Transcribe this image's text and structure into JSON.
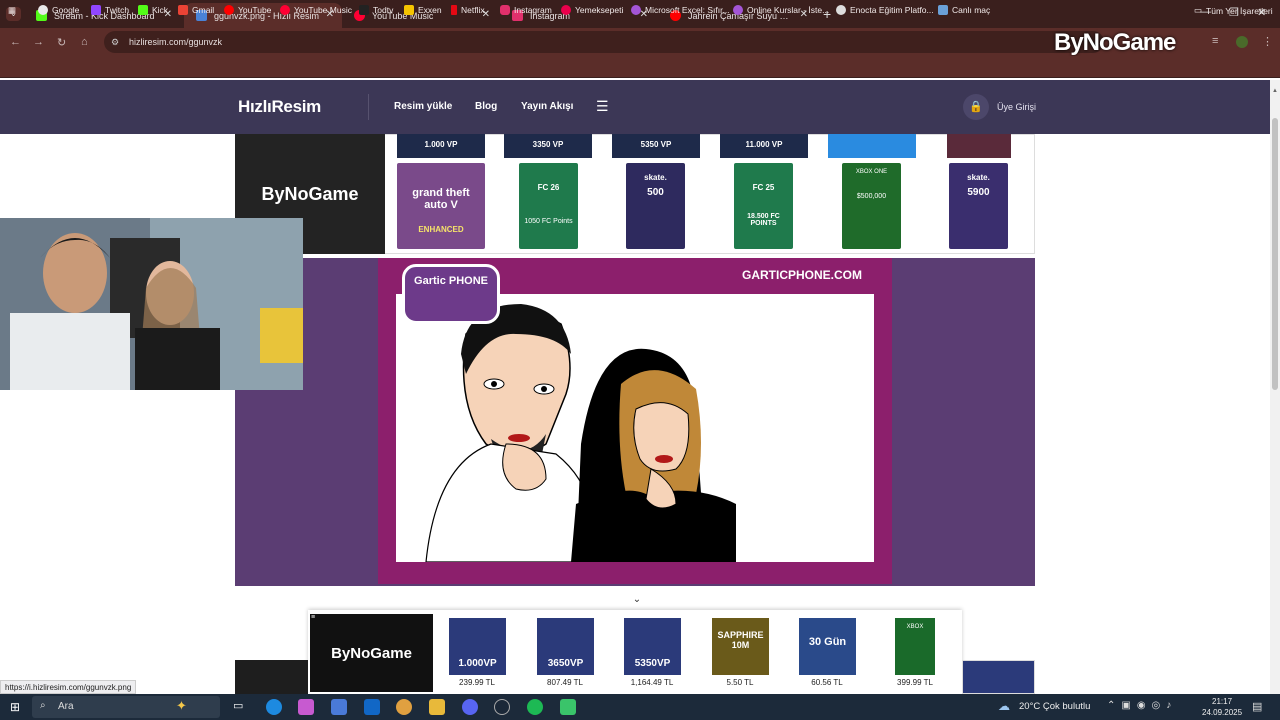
{
  "browser": {
    "tabs": [
      {
        "label": "Stream - Kick Dashboard",
        "color": "#53fc18"
      },
      {
        "label": "ggunvzk.png - Hızlı Resim",
        "color": "#3c3756"
      },
      {
        "label": "YouTube Music",
        "color": "#ff0033"
      },
      {
        "label": "Instagram",
        "color": "#e1306c"
      },
      {
        "label": "Jahrein Çamaşır Suyu Milkshake",
        "color": "#ff0000"
      }
    ],
    "new_tab": "+",
    "url": "hizliresim.com/ggunvzk",
    "bookmarks": [
      "Google",
      "Twitch",
      "Kick",
      "Gmail",
      "YouTube",
      "YouTube Music",
      "Todtv",
      "Exxen",
      "Netflix",
      "Instagram",
      "Yemeksepeti",
      "Microsoft Excel: Sıfır...",
      "Online Kurslar - İste...",
      "Enocta Eğitim Platfo...",
      "Canlı maç"
    ],
    "all_bookmarks": "Tüm Yer İşaretleri",
    "status_url": "https://i.hizliresim.com/ggunvzk.png"
  },
  "overlay_brand": "ByNoGame",
  "site": {
    "logo": "HızlıResim",
    "nav": [
      "Resim yükle",
      "Blog",
      "Yayın Akışı"
    ],
    "login": "Üye Girişi"
  },
  "ad_top": {
    "brand": "ByNoGame",
    "top_cards": [
      "1.000 VP",
      "3350 VP",
      "5350 VP",
      "11.000 VP"
    ],
    "cards": [
      {
        "title": "grand theft auto V",
        "sub": "ENHANCED",
        "color": "#7a4a8a"
      },
      {
        "title": "FC 26",
        "sub": "1050 FC Points",
        "color": "#1f7a4c"
      },
      {
        "title": "skate.",
        "sub": "500",
        "color": "#2e2a5e"
      },
      {
        "title": "FC 25",
        "sub": "18.500 FC POINTS",
        "color": "#1f7a4c"
      },
      {
        "title": "XBOX ONE",
        "sub": "$500,000",
        "color": "#1f6b2a"
      },
      {
        "title": "skate.",
        "sub": "5900",
        "color": "#3a2e6e"
      }
    ]
  },
  "image": {
    "watermark": "GARTICPHONE.COM",
    "logo_text": "Gartic PHONE"
  },
  "ad_bottom": {
    "brand": "ByNoGame",
    "items": [
      {
        "label": "1.000VP",
        "price": "239.99 TL",
        "color": "#2b3a7a"
      },
      {
        "label": "3650VP",
        "price": "807.49 TL",
        "color": "#2b3a7a"
      },
      {
        "label": "5350VP",
        "price": "1,164.49 TL",
        "color": "#2b3a7a"
      },
      {
        "label": "SAPPHIRE 10M",
        "price": "5.50 TL",
        "color": "#6a5a1a"
      },
      {
        "label": "30 Gün",
        "price": "60.56 TL",
        "color": "#2a4a8a"
      },
      {
        "label": "XBOX",
        "price": "399.99 TL",
        "color": "#1a6a2a"
      }
    ]
  },
  "taskbar": {
    "search": "Ara",
    "weather": "20°C  Çok bulutlu",
    "time": "21:17",
    "date": "24.09.2025"
  }
}
